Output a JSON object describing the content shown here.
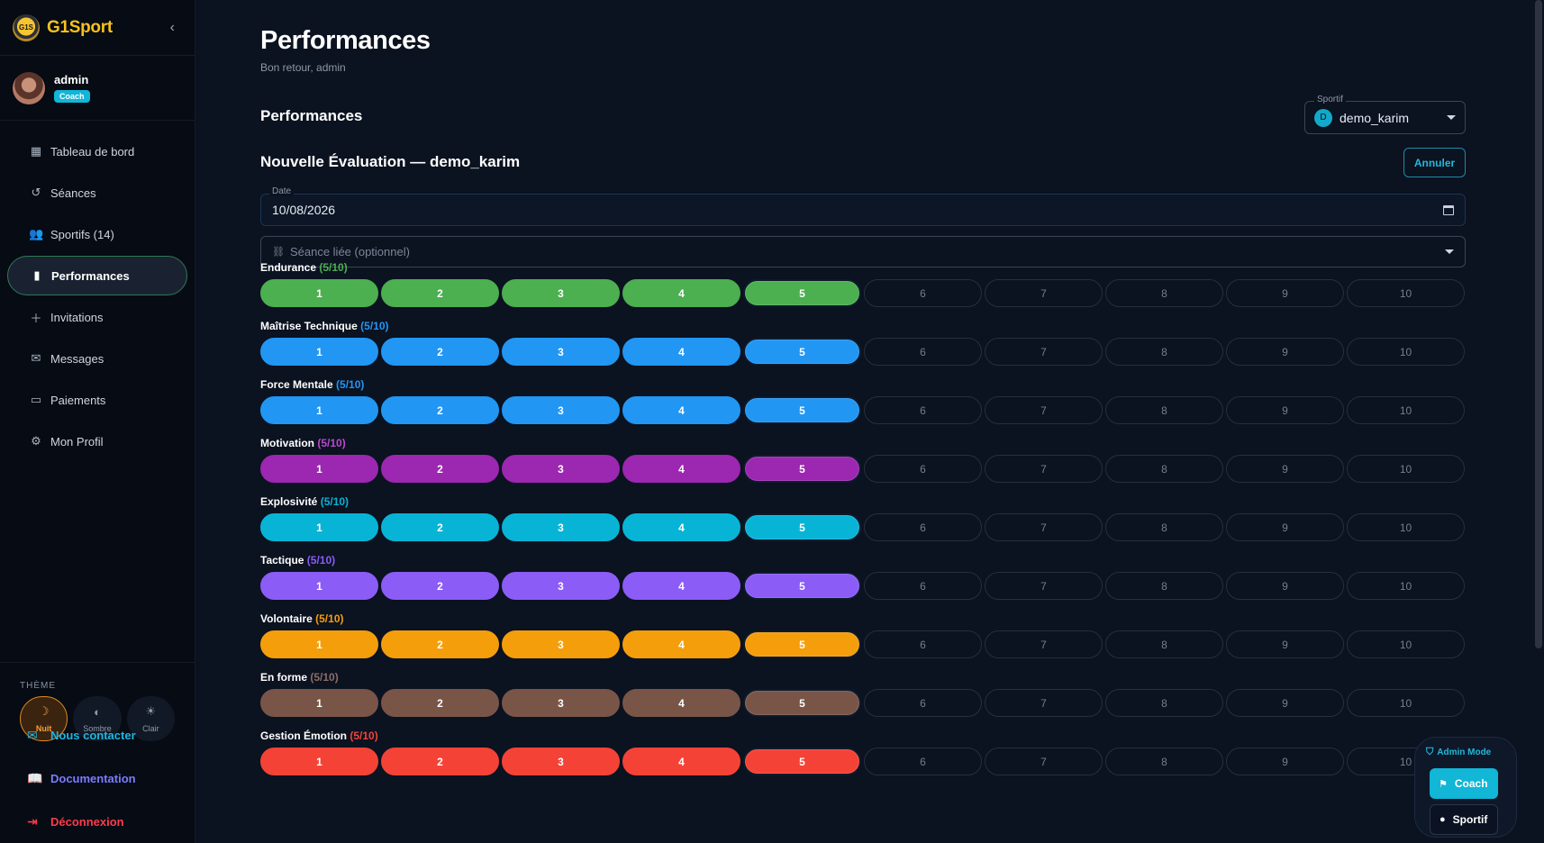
{
  "brand": {
    "name": "G1Sport",
    "logo_text": "G1S"
  },
  "user": {
    "name": "admin",
    "role": "Coach"
  },
  "nav": [
    {
      "label": "Tableau de bord",
      "icon": "dashboard-icon",
      "glyph": "▦"
    },
    {
      "label": "Séances",
      "icon": "history-icon",
      "glyph": "↺"
    },
    {
      "label": "Sportifs (14)",
      "icon": "people-icon",
      "glyph": "👥"
    },
    {
      "label": "Performances",
      "icon": "bar-chart-icon",
      "glyph": "▮",
      "active": true
    },
    {
      "label": "Invitations",
      "icon": "person-add-icon",
      "glyph": "＋"
    },
    {
      "label": "Messages",
      "icon": "chat-icon",
      "glyph": "✉"
    },
    {
      "label": "Paiements",
      "icon": "credit-card-icon",
      "glyph": "▭"
    },
    {
      "label": "Mon Profil",
      "icon": "profile-icon",
      "glyph": "⚙"
    }
  ],
  "theme": {
    "label": "THÈME",
    "options": [
      {
        "label": "Nuit",
        "glyph": "☽",
        "active": true
      },
      {
        "label": "Sombre",
        "glyph": "◐"
      },
      {
        "label": "Clair",
        "glyph": "☀"
      }
    ]
  },
  "bottom_links": {
    "contact": "Nous contacter",
    "docs": "Documentation",
    "logout": "Déconnexion"
  },
  "header": {
    "title": "Performances",
    "subtitle": "Bon retour, admin"
  },
  "section": {
    "title": "Performances"
  },
  "sportif_select": {
    "label": "Sportif",
    "value": "demo_karim",
    "initial": "D"
  },
  "evaluation": {
    "title": "Nouvelle Évaluation — demo_karim",
    "cancel_label": "Annuler",
    "date_label": "Date",
    "date_value": "10/08/2026",
    "seance_placeholder": "Séance liée (optionnel)"
  },
  "criteria": [
    {
      "label": "Endurance",
      "score": "(5/10)",
      "value": 5,
      "color": "#4caf50",
      "score_color": "#4caf50"
    },
    {
      "label": "Maîtrise Technique",
      "score": "(5/10)",
      "value": 5,
      "color": "#2196f3",
      "score_color": "#2196f3"
    },
    {
      "label": "Force Mentale",
      "score": "(5/10)",
      "value": 5,
      "color": "#2196f3",
      "score_color": "#2196f3"
    },
    {
      "label": "Motivation",
      "score": "(5/10)",
      "value": 5,
      "color": "#9c27b0",
      "score_color": "#b84ad0"
    },
    {
      "label": "Explosivité",
      "score": "(5/10)",
      "value": 5,
      "color": "#08b4d6",
      "score_color": "#08b4d6"
    },
    {
      "label": "Tactique",
      "score": "(5/10)",
      "value": 5,
      "color": "#8b5cf6",
      "score_color": "#8b5cf6"
    },
    {
      "label": "Volontaire",
      "score": "(5/10)",
      "value": 5,
      "color": "#f59e0b",
      "score_color": "#f59e0b"
    },
    {
      "label": "En forme",
      "score": "(5/10)",
      "value": 5,
      "color": "#795548",
      "score_color": "#8d6e63"
    },
    {
      "label": "Gestion Émotion",
      "score": "(5/10)",
      "value": 5,
      "color": "#f44336",
      "score_color": "#f44336"
    }
  ],
  "scale": [
    "1",
    "2",
    "3",
    "4",
    "5",
    "6",
    "7",
    "8",
    "9",
    "10"
  ],
  "admin_mode": {
    "title": "Admin Mode",
    "coach": "Coach",
    "sportif": "Sportif"
  }
}
